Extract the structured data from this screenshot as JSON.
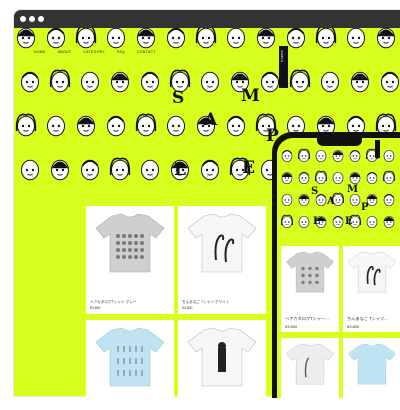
{
  "window": {
    "controls": [
      "close",
      "minimize",
      "maximize"
    ]
  },
  "nav": [
    "HOME",
    "ABOUT",
    "CATEGORY",
    "FAQ",
    "CONTACT"
  ],
  "sample": {
    "letters": [
      "S",
      "A",
      "M",
      "P",
      "L",
      "E"
    ],
    "tag": "SAMPLE"
  },
  "products": [
    {
      "name": "ヘアカタログTシャツ グレー",
      "price": "¥3,800"
    },
    {
      "name": "ちんあなご Tシャツ ホワイト",
      "price": "¥3,800"
    }
  ],
  "mobile_products": [
    {
      "name": "ヘアカタログTシャー...",
      "price": "¥3,800"
    },
    {
      "name": "ちんあなご Tシャツ...",
      "price": "¥3,800"
    }
  ],
  "colors": {
    "accent": "#d7ff1e",
    "dark": "#111111",
    "card": "#ffffff"
  }
}
